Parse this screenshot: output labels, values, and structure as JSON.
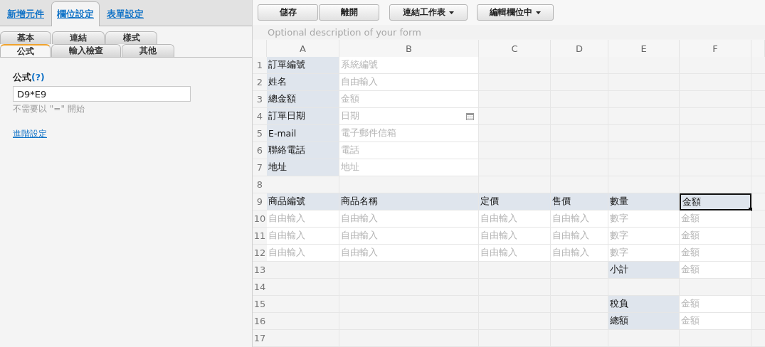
{
  "main_tabs": [
    {
      "label": "新增元件",
      "selected": false
    },
    {
      "label": "欄位設定",
      "selected": true
    },
    {
      "label": "表單設定",
      "selected": false
    }
  ],
  "sub_tab_rows": [
    [
      {
        "label": "基本",
        "selected": false
      },
      {
        "label": "連結",
        "selected": false
      },
      {
        "label": "樣式",
        "selected": false
      }
    ],
    [
      {
        "label": "公式",
        "selected": true
      },
      {
        "label": "輸入檢查",
        "selected": false
      },
      {
        "label": "其他",
        "selected": false
      }
    ]
  ],
  "formula": {
    "label": "公式",
    "help": "(?)",
    "value": "D9*E9",
    "hint": "不需要以 \"=\" 開始",
    "advanced_link": "進階設定"
  },
  "toolbar": [
    [
      {
        "label": "儲存",
        "menu": false
      },
      {
        "label": "離開",
        "menu": false
      }
    ],
    [
      {
        "label": "連結工作表",
        "menu": true
      }
    ],
    [
      {
        "label": "編輯欄位中",
        "menu": true
      }
    ]
  ],
  "description": {
    "placeholder": "Optional description of your form"
  },
  "spreadsheet": {
    "columns": [
      "A",
      "B",
      "C",
      "D",
      "E",
      "F"
    ],
    "rows": [
      {
        "number": "1",
        "cells": [
          {
            "kind": "label",
            "text": "訂單編號",
            "selected": false
          },
          {
            "kind": "input",
            "text": "系統編號",
            "selected": false
          },
          {
            "kind": "empty",
            "selected": false
          },
          {
            "kind": "empty",
            "selected": false
          },
          {
            "kind": "empty",
            "selected": false
          },
          {
            "kind": "empty",
            "selected": false
          }
        ]
      },
      {
        "number": "2",
        "cells": [
          {
            "kind": "label",
            "text": "姓名",
            "selected": false
          },
          {
            "kind": "input",
            "text": "自由輸入",
            "selected": false
          },
          {
            "kind": "empty",
            "selected": false
          },
          {
            "kind": "empty",
            "selected": false
          },
          {
            "kind": "empty",
            "selected": false
          },
          {
            "kind": "empty",
            "selected": false
          }
        ]
      },
      {
        "number": "3",
        "cells": [
          {
            "kind": "label",
            "text": "總金額",
            "selected": false
          },
          {
            "kind": "input",
            "text": "金額",
            "selected": false
          },
          {
            "kind": "empty",
            "selected": false
          },
          {
            "kind": "empty",
            "selected": false
          },
          {
            "kind": "empty",
            "selected": false
          },
          {
            "kind": "empty",
            "selected": false
          }
        ]
      },
      {
        "number": "4",
        "cells": [
          {
            "kind": "label",
            "text": "訂單日期",
            "selected": false
          },
          {
            "kind": "date",
            "text": "日期",
            "selected": false
          },
          {
            "kind": "empty",
            "selected": false
          },
          {
            "kind": "empty",
            "selected": false
          },
          {
            "kind": "empty",
            "selected": false
          },
          {
            "kind": "empty",
            "selected": false
          }
        ]
      },
      {
        "number": "5",
        "cells": [
          {
            "kind": "label",
            "text": "E-mail",
            "selected": false
          },
          {
            "kind": "input",
            "text": "電子郵件信箱",
            "selected": false
          },
          {
            "kind": "empty",
            "selected": false
          },
          {
            "kind": "empty",
            "selected": false
          },
          {
            "kind": "empty",
            "selected": false
          },
          {
            "kind": "empty",
            "selected": false
          }
        ]
      },
      {
        "number": "6",
        "cells": [
          {
            "kind": "label",
            "text": "聯絡電話",
            "selected": false
          },
          {
            "kind": "input",
            "text": "電話",
            "selected": false
          },
          {
            "kind": "empty",
            "selected": false
          },
          {
            "kind": "empty",
            "selected": false
          },
          {
            "kind": "empty",
            "selected": false
          },
          {
            "kind": "empty",
            "selected": false
          }
        ]
      },
      {
        "number": "7",
        "cells": [
          {
            "kind": "label",
            "text": "地址",
            "selected": false
          },
          {
            "kind": "input",
            "text": "地址",
            "selected": false
          },
          {
            "kind": "empty",
            "selected": false
          },
          {
            "kind": "empty",
            "selected": false
          },
          {
            "kind": "empty",
            "selected": false
          },
          {
            "kind": "empty",
            "selected": false
          }
        ]
      },
      {
        "number": "8",
        "cells": [
          {
            "kind": "empty",
            "selected": false
          },
          {
            "kind": "empty",
            "selected": false
          },
          {
            "kind": "empty",
            "selected": false
          },
          {
            "kind": "empty",
            "selected": false
          },
          {
            "kind": "empty",
            "selected": false
          },
          {
            "kind": "empty",
            "selected": false
          }
        ]
      },
      {
        "number": "9",
        "cells": [
          {
            "kind": "label",
            "text": "商品編號",
            "selected": false
          },
          {
            "kind": "label",
            "text": "商品名稱",
            "selected": false
          },
          {
            "kind": "label",
            "text": "定價",
            "selected": false
          },
          {
            "kind": "label",
            "text": "售價",
            "selected": false
          },
          {
            "kind": "label",
            "text": "數量",
            "selected": false
          },
          {
            "kind": "label",
            "text": "金額",
            "selected": true
          }
        ]
      },
      {
        "number": "10",
        "cells": [
          {
            "kind": "input",
            "text": "自由輸入",
            "selected": false
          },
          {
            "kind": "input",
            "text": "自由輸入",
            "selected": false
          },
          {
            "kind": "input",
            "text": "自由輸入",
            "selected": false
          },
          {
            "kind": "input",
            "text": "自由輸入",
            "selected": false
          },
          {
            "kind": "input",
            "text": "數字",
            "selected": false
          },
          {
            "kind": "input",
            "text": "金額",
            "selected": false
          }
        ]
      },
      {
        "number": "11",
        "cells": [
          {
            "kind": "input",
            "text": "自由輸入",
            "selected": false
          },
          {
            "kind": "input",
            "text": "自由輸入",
            "selected": false
          },
          {
            "kind": "input",
            "text": "自由輸入",
            "selected": false
          },
          {
            "kind": "input",
            "text": "自由輸入",
            "selected": false
          },
          {
            "kind": "input",
            "text": "數字",
            "selected": false
          },
          {
            "kind": "input",
            "text": "金額",
            "selected": false
          }
        ]
      },
      {
        "number": "12",
        "cells": [
          {
            "kind": "input",
            "text": "自由輸入",
            "selected": false
          },
          {
            "kind": "input",
            "text": "自由輸入",
            "selected": false
          },
          {
            "kind": "input",
            "text": "自由輸入",
            "selected": false
          },
          {
            "kind": "input",
            "text": "自由輸入",
            "selected": false
          },
          {
            "kind": "input",
            "text": "數字",
            "selected": false
          },
          {
            "kind": "input",
            "text": "金額",
            "selected": false
          }
        ]
      },
      {
        "number": "13",
        "cells": [
          {
            "kind": "empty",
            "selected": false
          },
          {
            "kind": "empty",
            "selected": false
          },
          {
            "kind": "empty",
            "selected": false
          },
          {
            "kind": "empty",
            "selected": false
          },
          {
            "kind": "label",
            "text": "小計",
            "selected": false
          },
          {
            "kind": "input",
            "text": "金額",
            "selected": false
          }
        ]
      },
      {
        "number": "14",
        "cells": [
          {
            "kind": "empty",
            "selected": false
          },
          {
            "kind": "empty",
            "selected": false
          },
          {
            "kind": "empty",
            "selected": false
          },
          {
            "kind": "empty",
            "selected": false
          },
          {
            "kind": "empty",
            "selected": false
          },
          {
            "kind": "empty",
            "selected": false
          }
        ]
      },
      {
        "number": "15",
        "cells": [
          {
            "kind": "empty",
            "selected": false
          },
          {
            "kind": "empty",
            "selected": false
          },
          {
            "kind": "empty",
            "selected": false
          },
          {
            "kind": "empty",
            "selected": false
          },
          {
            "kind": "label",
            "text": "稅負",
            "selected": false
          },
          {
            "kind": "input",
            "text": "金額",
            "selected": false
          }
        ]
      },
      {
        "number": "16",
        "cells": [
          {
            "kind": "empty",
            "selected": false
          },
          {
            "kind": "empty",
            "selected": false
          },
          {
            "kind": "empty",
            "selected": false
          },
          {
            "kind": "empty",
            "selected": false
          },
          {
            "kind": "label",
            "text": "總額",
            "selected": false
          },
          {
            "kind": "input",
            "text": "金額",
            "selected": false
          }
        ]
      },
      {
        "number": "17",
        "cells": [
          {
            "kind": "empty",
            "selected": false
          },
          {
            "kind": "empty",
            "selected": false
          },
          {
            "kind": "empty",
            "selected": false
          },
          {
            "kind": "empty",
            "selected": false
          },
          {
            "kind": "empty",
            "selected": false
          },
          {
            "kind": "empty",
            "selected": false
          }
        ]
      }
    ]
  }
}
